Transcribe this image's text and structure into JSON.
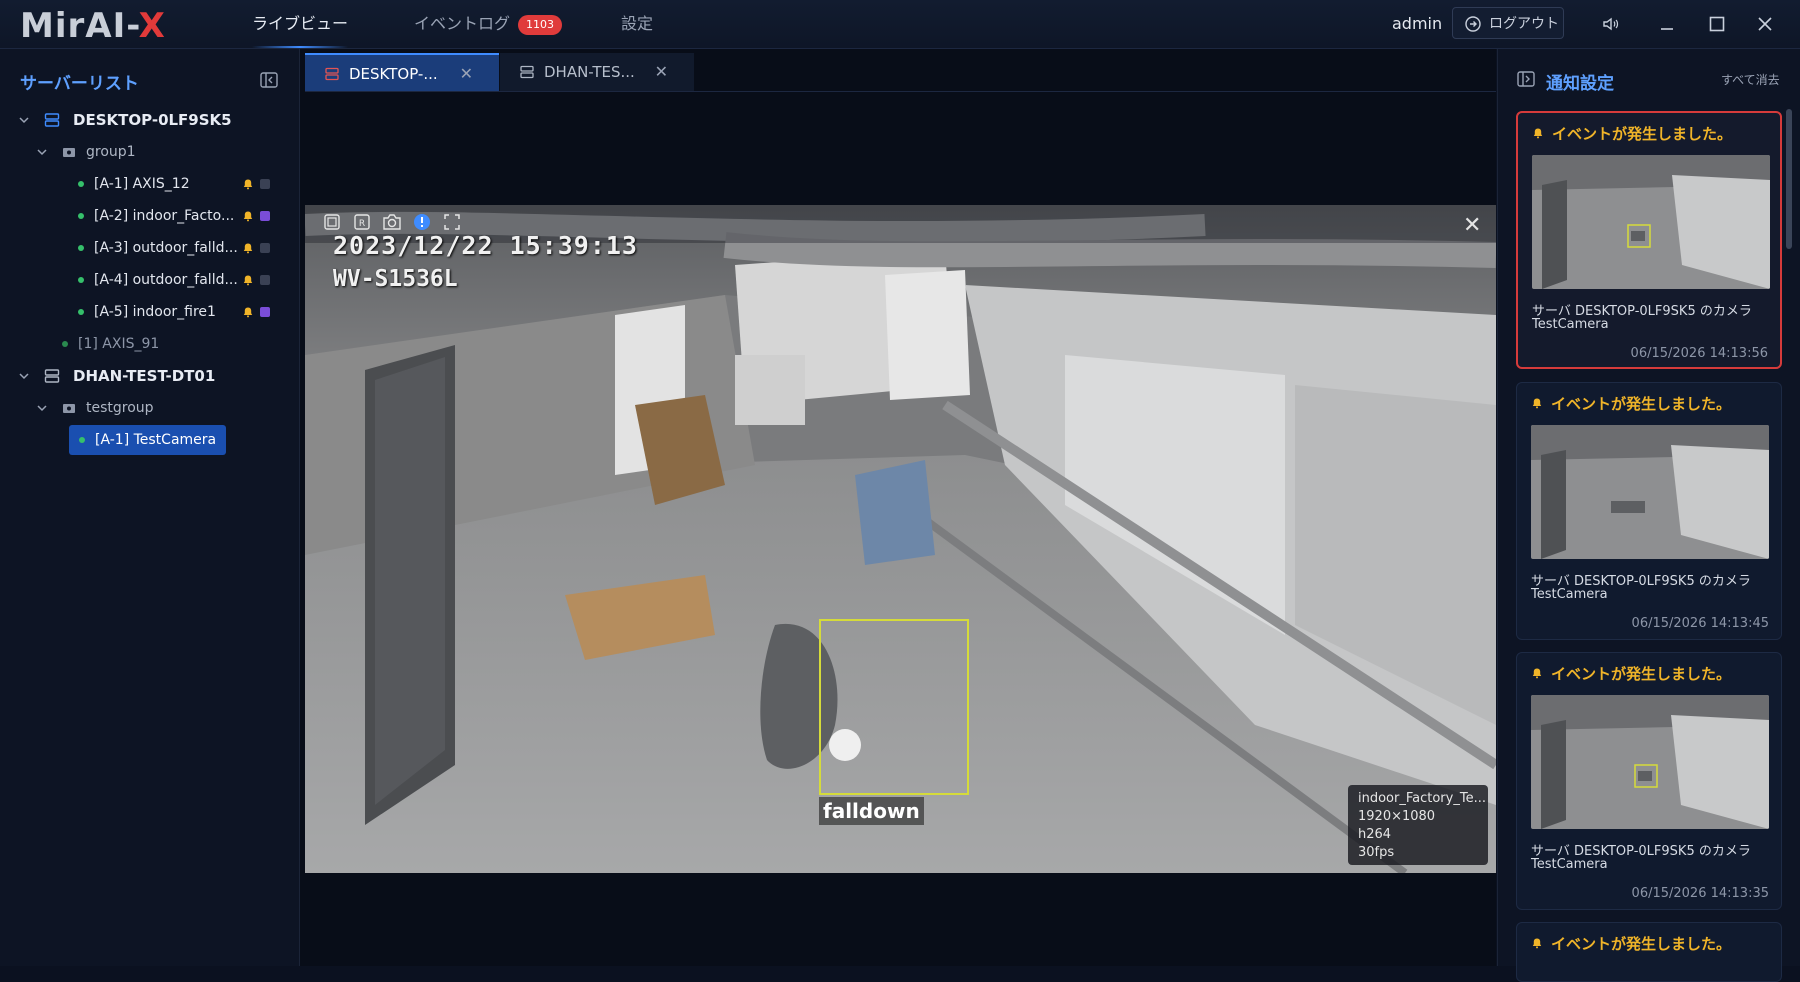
{
  "app": {
    "logo_part1": "MirAI-",
    "logo_part2": "X"
  },
  "nav": {
    "live_view": "ライブビュー",
    "event_log": "イベントログ",
    "event_log_badge": "1103",
    "settings": "設定"
  },
  "header": {
    "user": "admin",
    "logout": "ログアウト"
  },
  "sidebar": {
    "title": "サーバーリスト",
    "servers": [
      {
        "name": "DESKTOP-0LF9SK5",
        "group": "group1",
        "cameras": [
          "[A-1] AXIS_12",
          "[A-2] indoor_Facto...",
          "[A-3] outdoor_falld...",
          "[A-4] outdoor_falld...",
          "[A-5] indoor_fire1"
        ],
        "extra": "[1] AXIS_91"
      },
      {
        "name": "DHAN-TEST-DT01",
        "group": "testgroup",
        "cameras": [
          "[A-1] TestCamera"
        ]
      }
    ]
  },
  "tabs": [
    {
      "label": "DESKTOP-..."
    },
    {
      "label": "DHAN-TES..."
    }
  ],
  "video": {
    "timestamp": "2023/12/22 15:39:13",
    "camera_model": "WV-S1536L",
    "detection_label": "falldown",
    "info": {
      "name": "indoor_Factory_Te...",
      "resolution": "1920×1080",
      "codec": "h264",
      "fps": "30fps"
    }
  },
  "notifications": {
    "title": "通知設定",
    "clear_all": "すべて消去",
    "items": [
      {
        "title": "イベントが発生しました。",
        "line1": "サーバ DESKTOP-0LF9SK5 のカメラ",
        "line2": "TestCamera",
        "time": "06/15/2026 14:13:56"
      },
      {
        "title": "イベントが発生しました。",
        "line1": "サーバ DESKTOP-0LF9SK5 のカメラ",
        "line2": "TestCamera",
        "time": "06/15/2026 14:13:45"
      },
      {
        "title": "イベントが発生しました。",
        "line1": "サーバ DESKTOP-0LF9SK5 のカメラ",
        "line2": "TestCamera",
        "time": "06/15/2026 14:13:35"
      },
      {
        "title": "イベントが発生しました。"
      }
    ]
  },
  "colors": {
    "accent": "#3f8cff",
    "alert": "#d63b3b",
    "warning": "#f0b429",
    "online": "#35c06b"
  }
}
